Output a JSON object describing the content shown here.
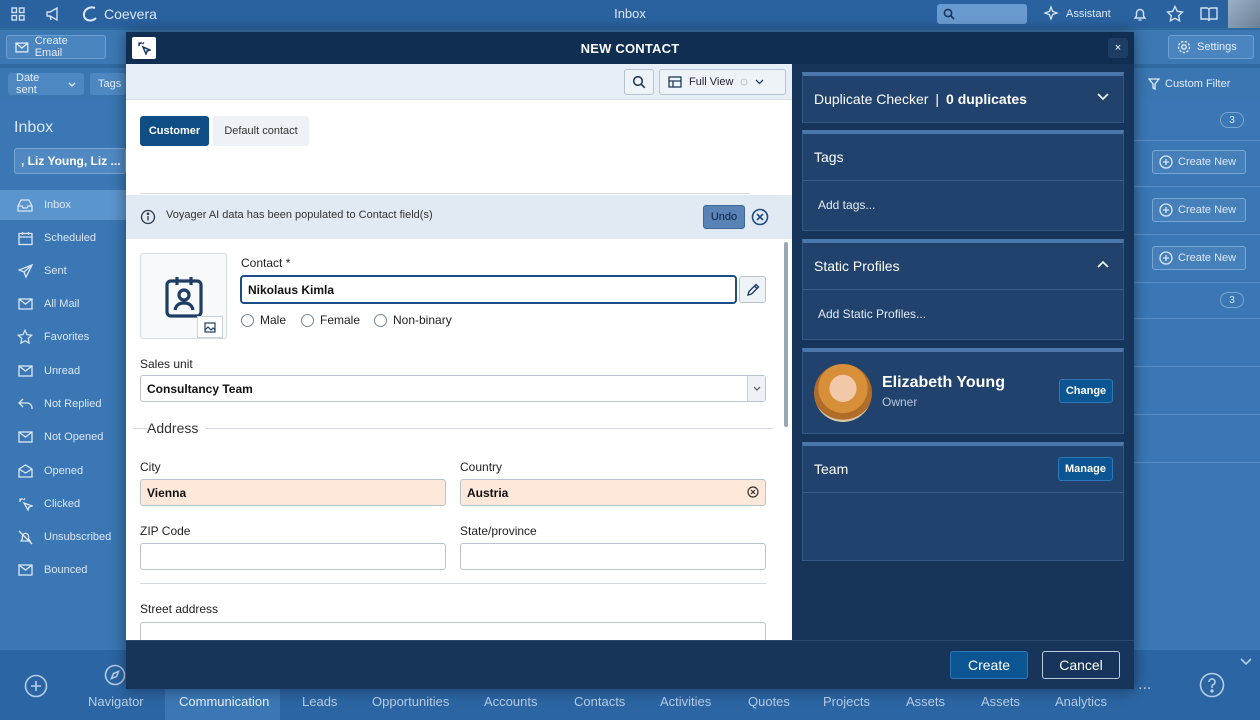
{
  "app": {
    "name": "Coevera",
    "window_title": "Inbox",
    "search_placeholder": "",
    "assistant_label": "Assistant"
  },
  "toolbar": {
    "create_email": "Create Email",
    "settings": "Settings"
  },
  "filters": {
    "date_sent": "Date sent",
    "tags": "Tags",
    "custom_filter": "Custom Filter"
  },
  "left_panel": {
    "title": "Inbox",
    "search_value": ", Liz Young, Liz ...",
    "items": [
      {
        "label": "Inbox",
        "icon": "inbox-icon"
      },
      {
        "label": "Scheduled",
        "icon": "calendar-icon"
      },
      {
        "label": "Sent",
        "icon": "send-icon"
      },
      {
        "label": "All Mail",
        "icon": "mail-icon"
      },
      {
        "label": "Favorites",
        "icon": "star-icon"
      },
      {
        "label": "Unread",
        "icon": "mail-icon"
      },
      {
        "label": "Not Replied",
        "icon": "reply-icon"
      },
      {
        "label": "Not Opened",
        "icon": "mail-icon"
      },
      {
        "label": "Opened",
        "icon": "mail-open-icon"
      },
      {
        "label": "Clicked",
        "icon": "cursor-icon"
      },
      {
        "label": "Unsubscribed",
        "icon": "bell-off-icon"
      },
      {
        "label": "Bounced",
        "icon": "mail-icon"
      }
    ]
  },
  "right_list": {
    "badges": [
      "3",
      "3"
    ],
    "create_new": "Create New"
  },
  "bottom_nav": {
    "items": [
      "Navigator",
      "Communication",
      "Leads",
      "Opportunities",
      "Accounts",
      "Contacts",
      "Activities",
      "Quotes",
      "Projects",
      "Assets",
      "Assets",
      "Analytics"
    ],
    "more": "..."
  },
  "modal": {
    "title": "NEW CONTACT",
    "close": "×",
    "view_mode": "Full View",
    "tabs": [
      "Customer",
      "Default contact"
    ],
    "info_message": "Voyager AI data has been populated to Contact field(s)",
    "undo": "Undo",
    "contact_label": "Contact *",
    "contact_value": "Nikolaus Kimla",
    "genders": [
      "Male",
      "Female",
      "Non-binary"
    ],
    "sales_unit_label": "Sales unit",
    "sales_unit_value": "Consultancy Team",
    "address_heading": "Address",
    "city_label": "City",
    "city_value": "Vienna",
    "country_label": "Country",
    "country_value": "Austria",
    "zip_label": "ZIP Code",
    "zip_value": "",
    "state_label": "State/province",
    "state_value": "",
    "street_label": "Street address",
    "create_button": "Create",
    "cancel_button": "Cancel"
  },
  "side_cards": {
    "duplicate_checker": {
      "label": "Duplicate Checker",
      "separator": "|",
      "count": "0 duplicates"
    },
    "tags": {
      "title": "Tags",
      "placeholder": "Add tags..."
    },
    "static_profiles": {
      "title": "Static Profiles",
      "placeholder": "Add Static Profiles..."
    },
    "owner": {
      "name": "Elizabeth Young",
      "role": "Owner",
      "button": "Change"
    },
    "team": {
      "title": "Team",
      "button": "Manage"
    }
  },
  "colors": {
    "accent": "#0c5593",
    "modal_bg": "#17355a",
    "card_bg": "#20426c",
    "filled_field": "#fde8da"
  }
}
